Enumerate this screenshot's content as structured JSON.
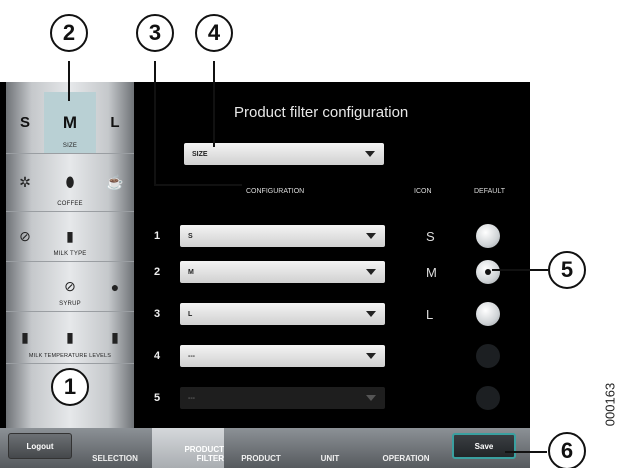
{
  "title": "Product filter configuration",
  "filter_dropdown": {
    "value": "SIZE"
  },
  "columns": {
    "configuration": "CONFIGURATION",
    "icon": "ICON",
    "default": "DEFAULT"
  },
  "rows": [
    {
      "num": "1",
      "value": "S",
      "icon": "S",
      "default": "unselected"
    },
    {
      "num": "2",
      "value": "M",
      "icon": "M",
      "default": "selected"
    },
    {
      "num": "3",
      "value": "L",
      "icon": "L",
      "default": "unselected"
    },
    {
      "num": "4",
      "value": "---",
      "icon": "",
      "default": "disabled"
    },
    {
      "num": "5",
      "value": "---",
      "icon": "",
      "default": "disabled"
    }
  ],
  "sidebar": {
    "size": {
      "s": "S",
      "m": "M",
      "l": "L",
      "label": "SIZE"
    },
    "coffee": {
      "label": "COFFEE",
      "icons": [
        "beans-icon",
        "bean-icon",
        "coffee-drop-icon"
      ]
    },
    "milk_type": {
      "label": "MILK TYPE",
      "icons": [
        "no-milk-icon",
        "milk-bottle-icon"
      ]
    },
    "syrup": {
      "label": "SYRUP",
      "icons": [
        "no-syrup-icon",
        "syrup-drop-icon"
      ]
    },
    "milk_temp": {
      "label": "MILK TEMPERATURE LEVELS",
      "icons": [
        "milk-cold-icon",
        "milk-warm-icon",
        "milk-hot-icon"
      ]
    }
  },
  "tabs": {
    "logout": "Logout",
    "selection": "SELECTION",
    "product_filter_1": "PRODUCT",
    "product_filter_2": "FILTER",
    "product": "PRODUCT",
    "unit": "UNIT",
    "operation": "OPERATION",
    "save": "Save"
  },
  "callouts": [
    "1",
    "2",
    "3",
    "4",
    "5",
    "6"
  ],
  "doc_id": "000163",
  "colors": {
    "accent": "#3aa0a0",
    "selected_cell": "#b9d0d4",
    "background": "#000000"
  }
}
